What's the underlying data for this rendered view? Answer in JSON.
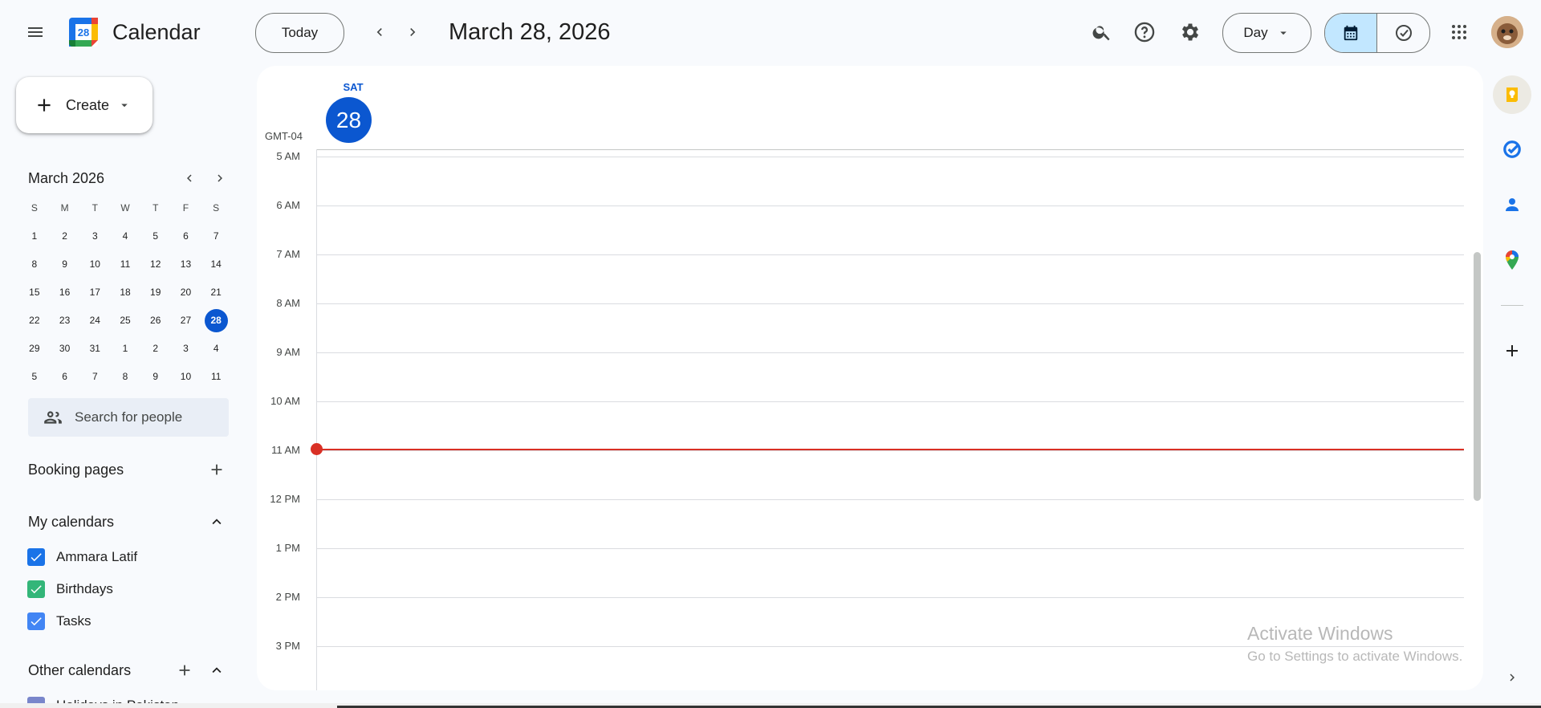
{
  "app": {
    "title": "Calendar",
    "logo_day": "28"
  },
  "header": {
    "today_label": "Today",
    "date_title": "March 28, 2026",
    "view_label": "Day"
  },
  "sidebar": {
    "create_label": "Create",
    "mini_calendar": {
      "month_label": "March 2026",
      "weekdays": [
        "S",
        "M",
        "T",
        "W",
        "T",
        "F",
        "S"
      ],
      "weeks": [
        [
          "1",
          "2",
          "3",
          "4",
          "5",
          "6",
          "7"
        ],
        [
          "8",
          "9",
          "10",
          "11",
          "12",
          "13",
          "14"
        ],
        [
          "15",
          "16",
          "17",
          "18",
          "19",
          "20",
          "21"
        ],
        [
          "22",
          "23",
          "24",
          "25",
          "26",
          "27",
          "28"
        ],
        [
          "29",
          "30",
          "31",
          "1",
          "2",
          "3",
          "4"
        ],
        [
          "5",
          "6",
          "7",
          "8",
          "9",
          "10",
          "11"
        ]
      ],
      "selected": "28"
    },
    "search_people_placeholder": "Search for people",
    "booking_pages_label": "Booking pages",
    "my_calendars_label": "My calendars",
    "my_calendars": [
      {
        "name": "Ammara Latif",
        "color": "#1a73e8"
      },
      {
        "name": "Birthdays",
        "color": "#33b679"
      },
      {
        "name": "Tasks",
        "color": "#4285f4"
      }
    ],
    "other_calendars_label": "Other calendars",
    "other_calendars": [
      {
        "name": "Holidays in Pakistan",
        "color": "#7986cb"
      }
    ]
  },
  "day_view": {
    "day_name": "SAT",
    "day_number": "28",
    "timezone": "GMT-04",
    "hours": [
      "5 AM",
      "6 AM",
      "7 AM",
      "8 AM",
      "9 AM",
      "10 AM",
      "11 AM",
      "12 PM",
      "1 PM",
      "2 PM",
      "3 PM"
    ]
  },
  "watermark": {
    "line1": "Activate Windows",
    "line2": "Go to Settings to activate Windows."
  },
  "colors": {
    "accent": "#0b57d0",
    "now_indicator": "#d93025",
    "background": "#f8fafd"
  }
}
